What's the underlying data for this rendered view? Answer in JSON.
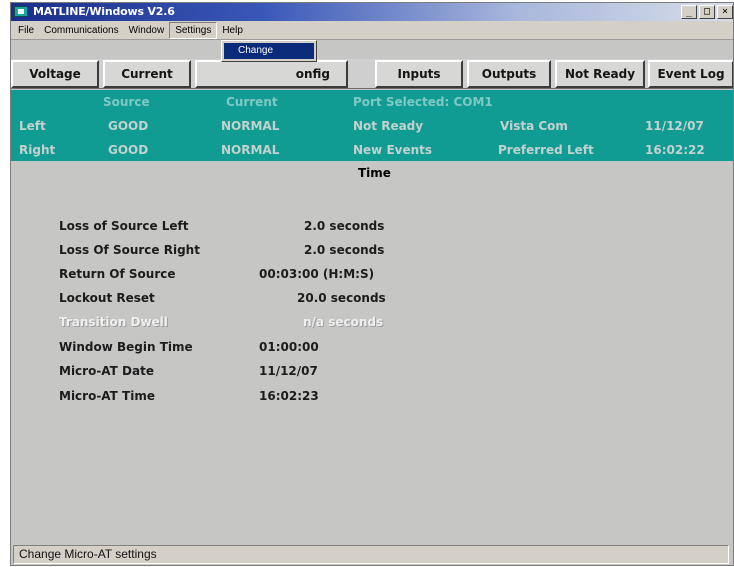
{
  "window": {
    "title": "MATLINE/Windows V2.6",
    "controls": {
      "minimize": "_",
      "maximize": "□",
      "close": "×"
    }
  },
  "menubar": [
    "File",
    "Communications",
    "Window",
    "Settings",
    "Help"
  ],
  "open_menu": {
    "parent": "Settings",
    "items": [
      "Change"
    ],
    "highlighted": "Change"
  },
  "toolbar": {
    "buttons": [
      "Voltage",
      "Current",
      "Config",
      "Inputs",
      "Outputs",
      "Not Ready",
      "Event Log"
    ],
    "visible_config_label": "onfig"
  },
  "status_panel": {
    "headers": {
      "source": "Source",
      "current": "Current",
      "port": "Port Selected: COM1"
    },
    "rows": [
      {
        "side": "Left",
        "source": "GOOD",
        "current": "NORMAL",
        "status": "Not Ready",
        "info": "Vista Com",
        "value": "11/12/07"
      },
      {
        "side": "Right",
        "source": "GOOD",
        "current": "NORMAL",
        "status": "New Events",
        "info": "Preferred Left",
        "value": "16:02:22"
      }
    ]
  },
  "main": {
    "section_title": "Time",
    "settings": [
      {
        "label": "Loss of Source Left",
        "value": "2.0 seconds",
        "enabled": true
      },
      {
        "label": "Loss Of Source Right",
        "value": "2.0 seconds",
        "enabled": true
      },
      {
        "label": "Return Of Source",
        "value": "00:03:00 (H:M:S)",
        "enabled": true
      },
      {
        "label": "Lockout Reset",
        "value": "20.0 seconds",
        "enabled": true
      },
      {
        "label": "Transition Dwell",
        "value": "n/a seconds",
        "enabled": false
      },
      {
        "label": "Window Begin Time",
        "value": "01:00:00",
        "enabled": true
      },
      {
        "label": "Micro-AT Date",
        "value": "11/12/07",
        "enabled": true
      },
      {
        "label": "Micro-AT Time",
        "value": "16:02:23",
        "enabled": true
      }
    ]
  },
  "statusbar": {
    "text": "Change Micro-AT settings"
  },
  "colors": {
    "panel": "#119c93",
    "titlebar_start": "#1a2e8a",
    "menu_highlight": "#0a2a7a",
    "window_bg": "#c6c7c4"
  }
}
